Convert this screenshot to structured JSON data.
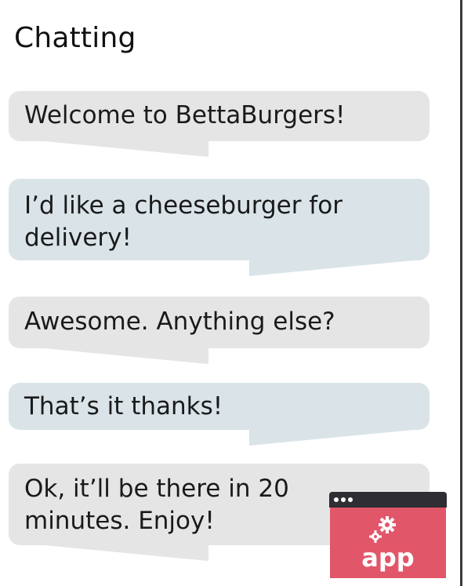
{
  "screen": {
    "title": "Chatting"
  },
  "messages": [
    {
      "sender": "incoming",
      "text": "Welcome to BettaBurgers!"
    },
    {
      "sender": "outgoing",
      "text": "I’d like a cheeseburger for delivery!"
    },
    {
      "sender": "incoming",
      "text": "Awesome. Anything else?"
    },
    {
      "sender": "outgoing",
      "text": "That’s it thanks!"
    },
    {
      "sender": "incoming",
      "text": "Ok, it’ll be there in 20 minutes. Enjoy!"
    }
  ],
  "badge": {
    "label": "app",
    "icon": "gears-icon",
    "colors": {
      "titlebar": "#2e2e33",
      "body": "#e2566a"
    }
  },
  "colors": {
    "incoming_bubble": "#e6e5e6",
    "outgoing_bubble": "#dae4e8"
  }
}
